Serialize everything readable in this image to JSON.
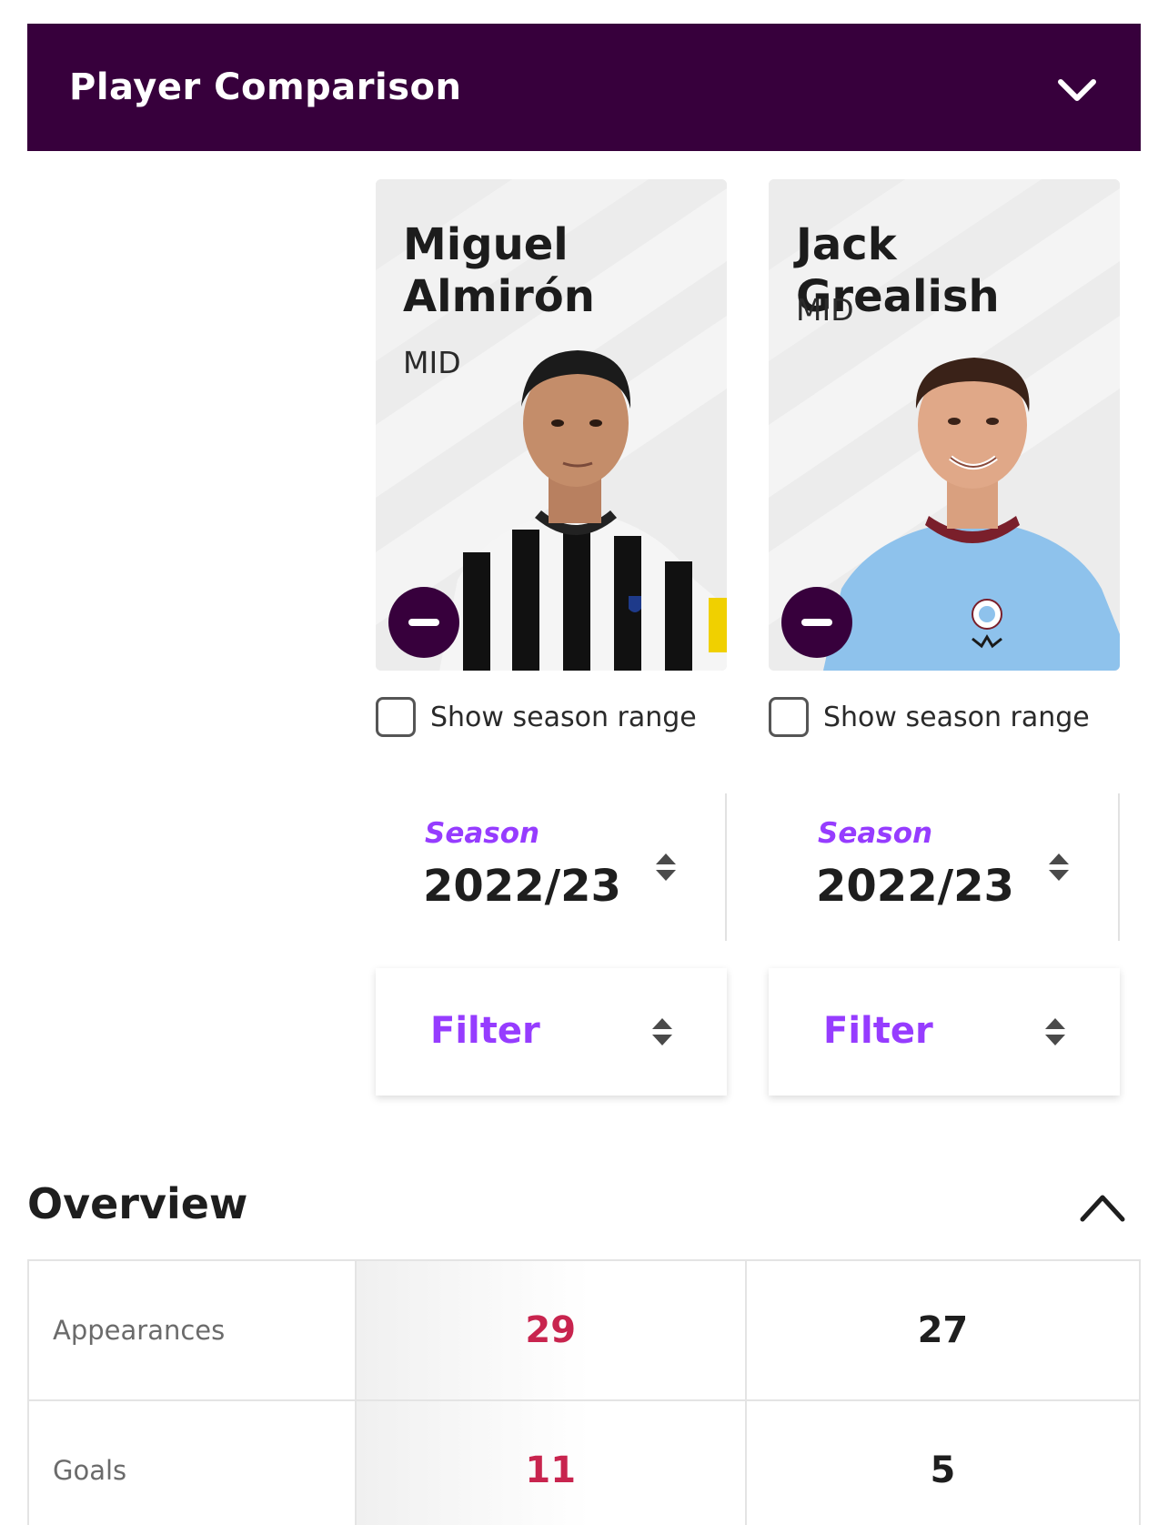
{
  "header": {
    "title": "Player Comparison"
  },
  "players": [
    {
      "name": "Miguel Almirón",
      "position": "MID",
      "season_range_label": "Show season range",
      "season_label": "Season",
      "season_value": "2022/23",
      "filter_label": "Filter",
      "kit": "newcastle"
    },
    {
      "name": "Jack Grealish",
      "position": "MID",
      "season_range_label": "Show season range",
      "season_label": "Season",
      "season_value": "2022/23",
      "filter_label": "Filter",
      "kit": "man-city"
    }
  ],
  "overview": {
    "title": "Overview",
    "rows": [
      {
        "label": "Appearances",
        "values": [
          "29",
          "27"
        ]
      },
      {
        "label": "Goals",
        "values": [
          "11",
          "5"
        ]
      }
    ]
  },
  "colors": {
    "brand": "#37003c",
    "accent": "#963cff",
    "highlight": "#c8244e"
  }
}
